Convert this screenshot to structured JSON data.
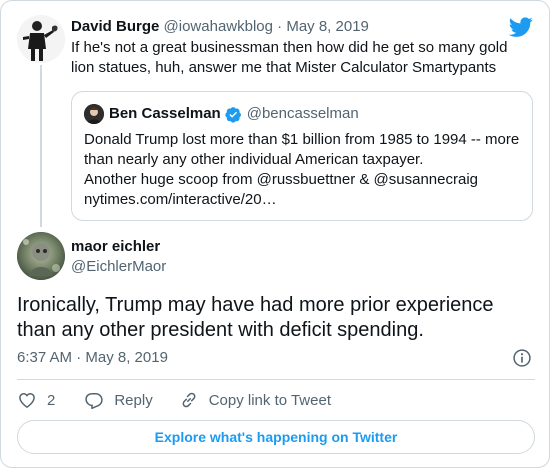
{
  "parent": {
    "name": "David Burge",
    "handle": "@iowahawkblog",
    "separator": "·",
    "date": "May 8, 2019",
    "text": "If he's not a great businessman then how did he get so many gold lion statues, huh, answer me that Mister Calculator Smartypants"
  },
  "quoted": {
    "name": "Ben Casselman",
    "handle": "@bencasselman",
    "lines": [
      "Donald Trump lost more than $1 billion from 1985 to 1994 -- more",
      "than nearly any other individual American taxpayer.",
      "Another huge scoop from @russbuettner & @susannecraig",
      "nytimes.com/interactive/20…"
    ]
  },
  "tweet": {
    "name": "maor eichler",
    "handle": "@EichlerMaor",
    "text": "Ironically, Trump may have had more prior experience than any other president with deficit spending.",
    "time": "6:37 AM · May 8, 2019"
  },
  "actions": {
    "like_count": "2",
    "reply_label": "Reply",
    "copy_label": "Copy link to Tweet"
  },
  "explore_label": "Explore what's happening on Twitter",
  "colors": {
    "accent": "#1d9bf0",
    "text": "#0f1419",
    "secondary": "#536471",
    "border": "#cfd9de"
  },
  "icons": [
    "twitter-bird-icon",
    "verified-badge-icon",
    "info-icon",
    "heart-icon",
    "reply-icon",
    "link-icon"
  ]
}
